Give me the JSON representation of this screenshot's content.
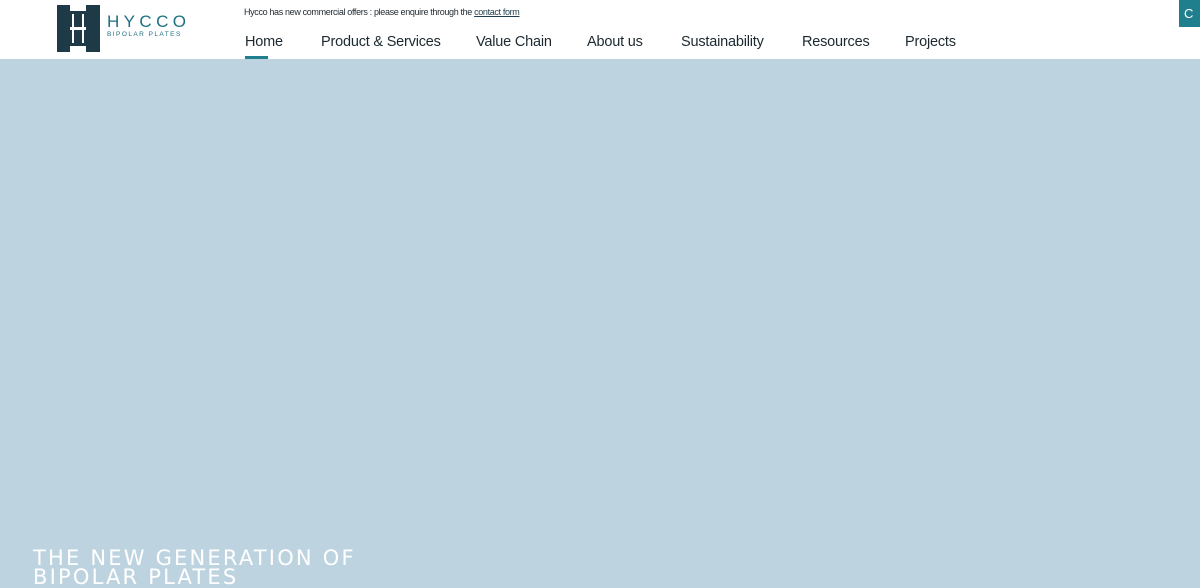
{
  "brand": {
    "name": "HYCCO",
    "tagline": "BIPOLAR PLATES",
    "colors": {
      "primary": "#1f6f82",
      "dark": "#1e3a47",
      "accent": "#1f7f8c",
      "hero_bg": "#bed3e0"
    }
  },
  "announcement": {
    "text": "Hycco has new commercial offers : please enquire through the ",
    "link_label": "contact form"
  },
  "nav": {
    "items": [
      {
        "label": "Home",
        "active": true
      },
      {
        "label": "Product & Services"
      },
      {
        "label": "Value Chain"
      },
      {
        "label": "About us"
      },
      {
        "label": "Sustainability"
      },
      {
        "label": "Resources"
      },
      {
        "label": "Projects"
      }
    ]
  },
  "corner_button": {
    "label": "C"
  },
  "hero": {
    "title_line1": "THE NEW GENERATION OF",
    "title_line2": "BIPOLAR PLATES"
  }
}
